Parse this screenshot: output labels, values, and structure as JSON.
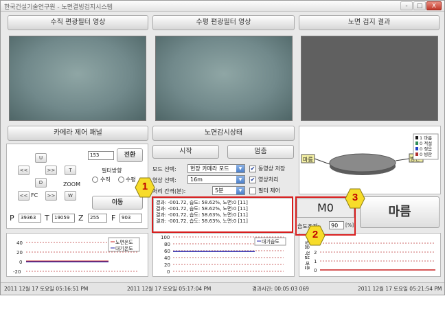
{
  "titlebar": {
    "title": "한국건설기술연구원 - 노면결빙검지시스템",
    "min": "-",
    "max": "□",
    "close": "X"
  },
  "headers": {
    "vertical_video": "수직 편광필터 영상",
    "horizontal_video": "수평 편광필터 영상",
    "detect_result": "노면 검지 결과",
    "camera_panel": "카메라 제어 패널",
    "road_status": "노면감시상태"
  },
  "camera": {
    "up": "U",
    "down": "D",
    "left": "<<",
    "right": ">>",
    "t_btn": "T",
    "w_btn": "W",
    "zoom": "ZOOM",
    "fc": "FC",
    "left2": "<<",
    "right2": ">>",
    "preset_value": "153",
    "switch_btn": "전환",
    "filter_dir_label": "필터방향",
    "radio_vertical": "수직",
    "radio_horizontal": "수평",
    "move_btn": "이동",
    "p_label": "P",
    "p_value": "39363",
    "t_label": "T",
    "t_value": "19059",
    "z_label": "Z",
    "z_value": "255",
    "f_label": "F",
    "f_value": "903"
  },
  "monitor": {
    "start_btn": "시작",
    "stop_btn": "멈춤",
    "mode_label": "모드 선택:",
    "mode_value": "현장 카메라 모드",
    "video_label": "영상 선택:",
    "video_value": "16m",
    "interval_label": "처리 간격(분):",
    "interval_value": "5분",
    "save_video": "동영상 저장",
    "save_video_checked": "✔",
    "image_proc": "영상처리",
    "image_proc_checked": "✔",
    "filter_ctrl": "필터 제어",
    "log_lines": [
      "결과: -001.72, 습도: 58.62%, 노면:0  [11]",
      "결과: -001.72, 습도: 58.62%, 노면:0  [11]",
      "결과: -001.72, 습도: 58.63%, 노면:0  [11]",
      "결과: -001.72, 습도: 58.63%, 노면:0  [11]"
    ]
  },
  "result": {
    "code": "M0",
    "state_btn": "마름",
    "humidity_label": "습도조건:",
    "humidity_value": "90",
    "humidity_unit": "[%]",
    "pie_left_label": "마름",
    "pie_right_label": "빙판",
    "legend": [
      "1 마름",
      "0 적설",
      "0 젖음",
      "0 빙판"
    ],
    "legend_colors": [
      "#1a1a1a",
      "#2e8b57",
      "#1e40c8",
      "#b03030"
    ]
  },
  "markers": [
    "1",
    "2",
    "3"
  ],
  "charts": {
    "temp": {
      "legend": [
        "노면온도",
        "대기온도"
      ],
      "yticks": [
        "40",
        "20",
        "0",
        "-20"
      ]
    },
    "humid": {
      "legend": [
        "대기습도"
      ],
      "yticks": [
        "100",
        "80",
        "60",
        "40",
        "20",
        "0"
      ]
    },
    "state": {
      "ylabel": "젖음 적설 마름",
      "yticks": [
        "3",
        "2",
        "1",
        "0"
      ]
    }
  },
  "chart_data": [
    {
      "type": "line",
      "title": "",
      "series": [
        {
          "name": "노면온도",
          "values": [
            0,
            0,
            0,
            0,
            0,
            0
          ]
        },
        {
          "name": "대기온도",
          "values": [
            0,
            0,
            0,
            0,
            0,
            0
          ]
        }
      ],
      "ylim": [
        -20,
        40
      ],
      "yticks": [
        40,
        20,
        0,
        -20
      ],
      "grid": true,
      "legend": "top-right"
    },
    {
      "type": "line",
      "title": "",
      "series": [
        {
          "name": "대기습도",
          "values": [
            59,
            59,
            59,
            59,
            59,
            59
          ]
        }
      ],
      "ylim": [
        0,
        100
      ],
      "yticks": [
        0,
        20,
        40,
        60,
        80,
        100
      ],
      "grid": true,
      "legend": "top-right"
    },
    {
      "type": "line",
      "title": "",
      "series": [
        {
          "values": [
            0,
            0,
            0,
            0,
            0,
            0
          ]
        }
      ],
      "ylim": [
        0,
        3
      ],
      "yticks": [
        0,
        1,
        2,
        3
      ],
      "grid": true
    },
    {
      "type": "pie",
      "title": "",
      "categories": [
        "마름",
        "적설",
        "젖음",
        "빙판"
      ],
      "values": [
        1,
        0,
        0,
        0
      ]
    }
  ],
  "status": {
    "start_time": "2011 12월 17 토요일 05:16:51 PM",
    "last_time": "2011 12월 17 토요일 05:17:04 PM",
    "elapsed": "경과시간: 00:05:03 069",
    "current_time": "2011 12월 17 토요일 05:21:54 PM"
  }
}
